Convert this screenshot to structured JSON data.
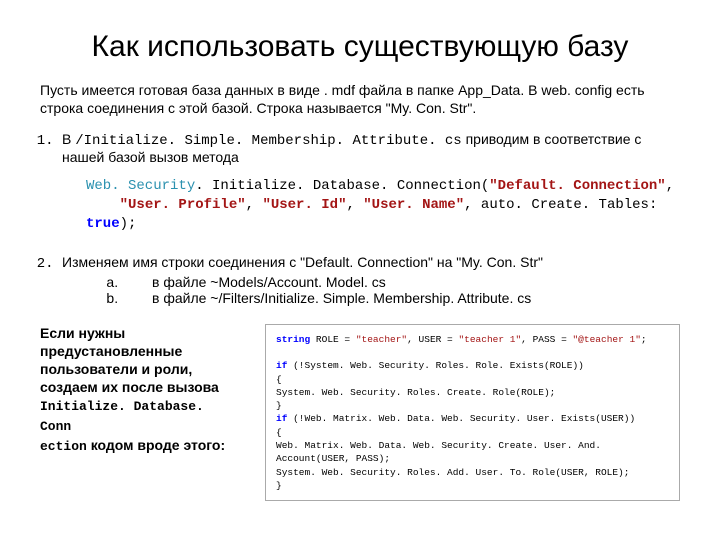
{
  "title": "Как использовать существующую базу",
  "intro": "Пусть имеется готовая база данных в виде . mdf файла в папке App_Data. В web. config есть строка соединения с этой базой. Строка называется \"My. Con. Str\".",
  "step1": {
    "prefix": "В ",
    "path": "/Initialize. Simple. Membership. Attribute. cs",
    "suffix": " приводим в соответствие с нашей базой вызов метода"
  },
  "code1": {
    "cls": "Web. Security",
    "method": ". Initialize. Database. Connection(",
    "arg1": "\"Default. Connection\"",
    "arg2": "\"User. Profile\"",
    "arg3": "\"User. Id\"",
    "arg4": "\"User. Name\"",
    "arg5_name": "auto. Create. Tables: ",
    "arg5_val": "true",
    "close": ");"
  },
  "step2": {
    "text": "Изменяем имя строки соединения с \"Default. Connection\"  на \"My. Con. Str\"",
    "a": "в файле ~Models/Account. Model. cs",
    "b": "в файле ~/Filters/Initialize. Simple. Membership. Attribute. cs"
  },
  "note": {
    "l1": "Если нужны",
    "l2": "предустановленные",
    "l3": "пользователи и роли,",
    "l4": "создаем их после вызова",
    "mono": "Initialize. Database. Conn",
    "mono2": "ection",
    "l5": "  кодом вроде этого:"
  },
  "code2": {
    "l1a": "string",
    "l1b": " ROLE = ",
    "l1c": "\"teacher\"",
    "l1d": ", USER = ",
    "l1e": "\"teacher 1\"",
    "l1f": ", PASS = ",
    "l1g": "\"@teacher 1\"",
    "l1h": ";",
    "l2a": "if",
    "l2b": " (!System. Web. Security. Roles. Role. Exists(ROLE))",
    "l3": "{",
    "l4": "    System. Web. Security. Roles. Create. Role(ROLE);",
    "l5": "}",
    "l6a": "if",
    "l6b": " (!Web. Matrix. Web. Data. Web. Security. User. Exists(USER))",
    "l7": "{",
    "l8": "    Web. Matrix. Web. Data. Web. Security. Create. User. And. Account(USER, PASS);",
    "l9": "    System. Web. Security. Roles. Add. User. To. Role(USER, ROLE);",
    "l10": "}"
  }
}
